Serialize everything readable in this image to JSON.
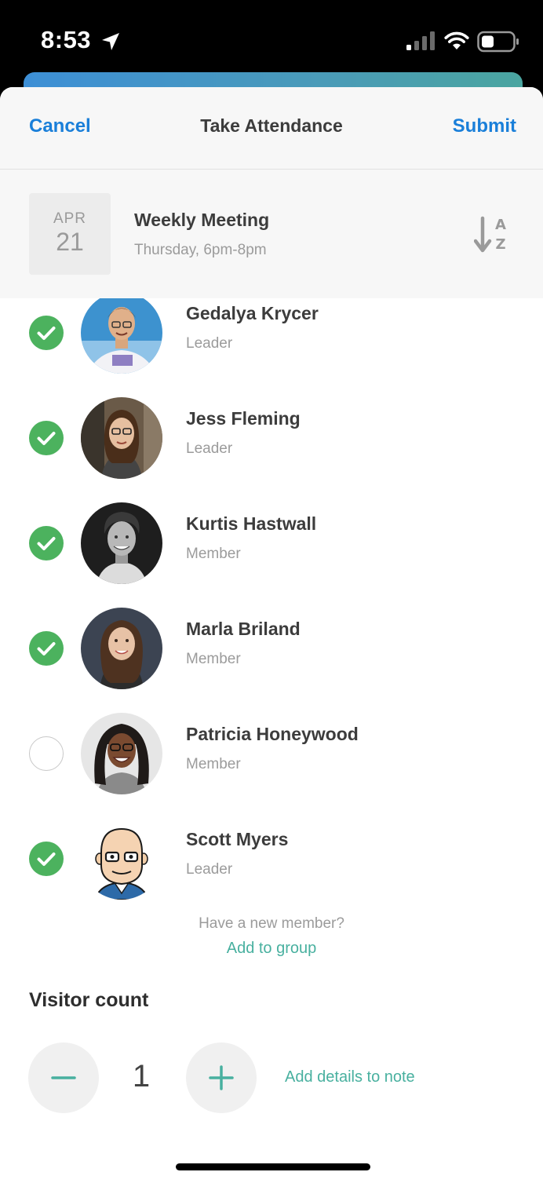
{
  "status_bar": {
    "time": "8:53",
    "icons": [
      "location-arrow-icon",
      "cellular-signal-icon",
      "wifi-icon",
      "battery-icon"
    ]
  },
  "nav": {
    "cancel": "Cancel",
    "title": "Take Attendance",
    "submit": "Submit"
  },
  "event": {
    "month": "APR",
    "day": "21",
    "title": "Weekly Meeting",
    "schedule": "Thursday, 6pm-8pm",
    "sort_icon": "sort-a-z-icon"
  },
  "members": [
    {
      "name": "Gedalya Krycer",
      "role": "Leader",
      "present": true
    },
    {
      "name": "Jess Fleming",
      "role": "Leader",
      "present": true
    },
    {
      "name": "Kurtis Hastwall",
      "role": "Member",
      "present": true
    },
    {
      "name": "Marla Briland",
      "role": "Member",
      "present": true
    },
    {
      "name": "Patricia Honeywood",
      "role": "Member",
      "present": false
    },
    {
      "name": "Scott Myers",
      "role": "Leader",
      "present": true
    }
  ],
  "add_member": {
    "question": "Have a new member?",
    "link": "Add to group"
  },
  "visitor": {
    "title": "Visitor count",
    "count": "1",
    "add_details": "Add details to note"
  },
  "colors": {
    "accent_blue": "#1a7fd9",
    "check_green": "#4cb25e",
    "teal_link": "#48b09f"
  }
}
